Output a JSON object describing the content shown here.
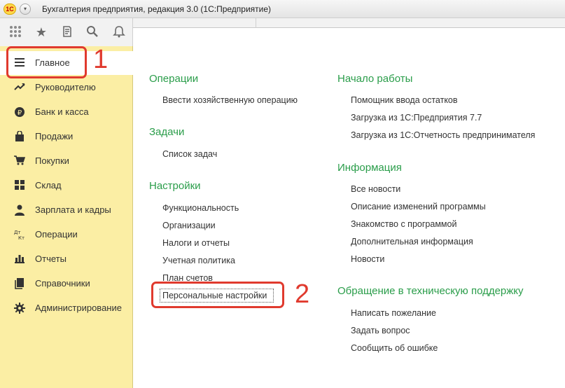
{
  "window": {
    "title": "Бухгалтерия предприятия, редакция 3.0  (1С:Предприятие)",
    "logo_text": "1С"
  },
  "toolbar": {
    "icons": [
      "apps-grid-icon",
      "star-icon",
      "history-icon",
      "search-icon",
      "bell-icon"
    ]
  },
  "sidebar": {
    "items": [
      {
        "label": "Главное",
        "icon": "menu-lines-icon",
        "active": true
      },
      {
        "label": "Руководителю",
        "icon": "trend-up-icon"
      },
      {
        "label": "Банк и касса",
        "icon": "ruble-coin-icon"
      },
      {
        "label": "Продажи",
        "icon": "shopping-bag-icon"
      },
      {
        "label": "Покупки",
        "icon": "cart-icon"
      },
      {
        "label": "Склад",
        "icon": "warehouse-grid-icon"
      },
      {
        "label": "Зарплата и кадры",
        "icon": "person-icon"
      },
      {
        "label": "Операции",
        "icon": "debit-credit-icon",
        "icon_text": "Дт Кт"
      },
      {
        "label": "Отчеты",
        "icon": "bar-chart-icon"
      },
      {
        "label": "Справочники",
        "icon": "books-icon"
      },
      {
        "label": "Администрирование",
        "icon": "gear-icon"
      }
    ]
  },
  "content": {
    "left": {
      "operations": {
        "title": "Операции",
        "links": [
          "Ввести хозяйственную операцию"
        ]
      },
      "tasks": {
        "title": "Задачи",
        "links": [
          "Список задач"
        ]
      },
      "settings": {
        "title": "Настройки",
        "links": [
          "Функциональность",
          "Организации",
          "Налоги и отчеты",
          "Учетная политика",
          "План счетов",
          "Персональные настройки"
        ]
      }
    },
    "right": {
      "start": {
        "title": "Начало работы",
        "links": [
          "Помощник ввода остатков",
          "Загрузка из 1С:Предприятия 7.7",
          "Загрузка из 1С:Отчетность предпринимателя"
        ]
      },
      "info": {
        "title": "Информация",
        "links": [
          "Все новости",
          "Описание изменений программы",
          "Знакомство с программой",
          "Дополнительная информация",
          "Новости"
        ]
      },
      "support": {
        "title": "Обращение в техническую поддержку",
        "links": [
          "Написать пожелание",
          "Задать вопрос",
          "Сообщить об ошибке"
        ]
      }
    }
  },
  "annotations": {
    "step1": "1",
    "step2": "2",
    "color": "#e03a2e"
  }
}
